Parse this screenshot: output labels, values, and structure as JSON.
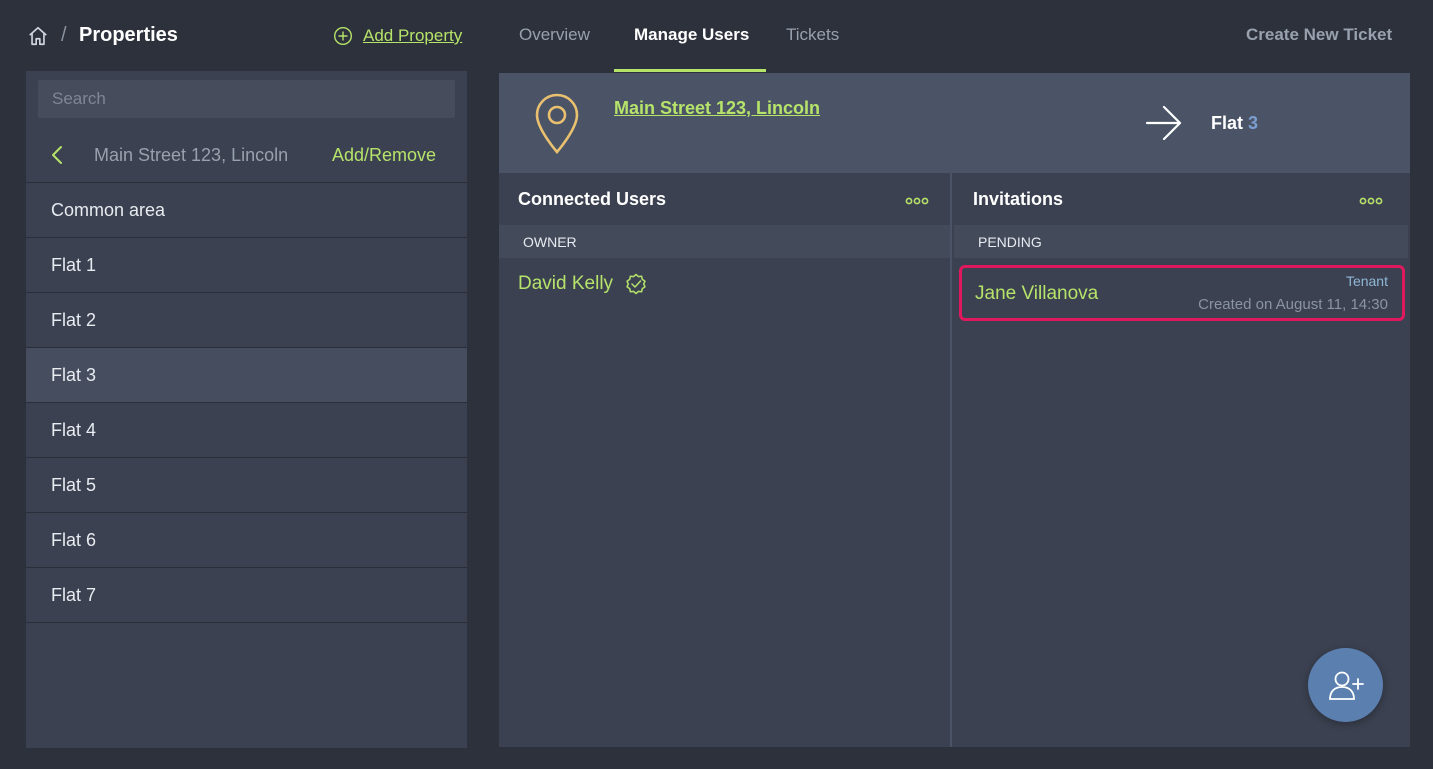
{
  "header": {
    "breadcrumb_sep": "/",
    "title": "Properties",
    "add_property_label": "Add Property",
    "tabs": [
      {
        "label": "Overview",
        "active": false
      },
      {
        "label": "Manage Users",
        "active": true
      },
      {
        "label": "Tickets",
        "active": false
      }
    ],
    "create_ticket_label": "Create New Ticket"
  },
  "sidebar": {
    "search_placeholder": "Search",
    "current_property": "Main Street 123, Lincoln",
    "add_remove_label": "Add/Remove",
    "units": [
      {
        "label": "Common area",
        "selected": false
      },
      {
        "label": "Flat 1",
        "selected": false
      },
      {
        "label": "Flat 2",
        "selected": false
      },
      {
        "label": "Flat 3",
        "selected": true
      },
      {
        "label": "Flat 4",
        "selected": false
      },
      {
        "label": "Flat 5",
        "selected": false
      },
      {
        "label": "Flat 6",
        "selected": false
      },
      {
        "label": "Flat 7",
        "selected": false
      }
    ]
  },
  "property_header": {
    "address": "Main Street 123, Lincoln",
    "unit_prefix": "Flat",
    "unit_number": "3"
  },
  "connected_users": {
    "title": "Connected Users",
    "section_label": "OWNER",
    "users": [
      {
        "name": "David Kelly",
        "verified": true
      }
    ]
  },
  "invitations": {
    "title": "Invitations",
    "section_label": "PENDING",
    "items": [
      {
        "name": "Jane Villanova",
        "role": "Tenant",
        "created": "Created on August 11, 14:30"
      }
    ]
  },
  "colors": {
    "accent": "#b6e36a",
    "background": "#2d313b",
    "panel": "#3b4150",
    "highlight_border": "#e0195f",
    "fab": "#5b80b0"
  },
  "icons": [
    "home-icon",
    "plus-circle-icon",
    "chevron-left-icon",
    "map-pin-icon",
    "arrow-right-icon",
    "more-dots-icon",
    "verified-badge-icon",
    "add-user-icon"
  ]
}
